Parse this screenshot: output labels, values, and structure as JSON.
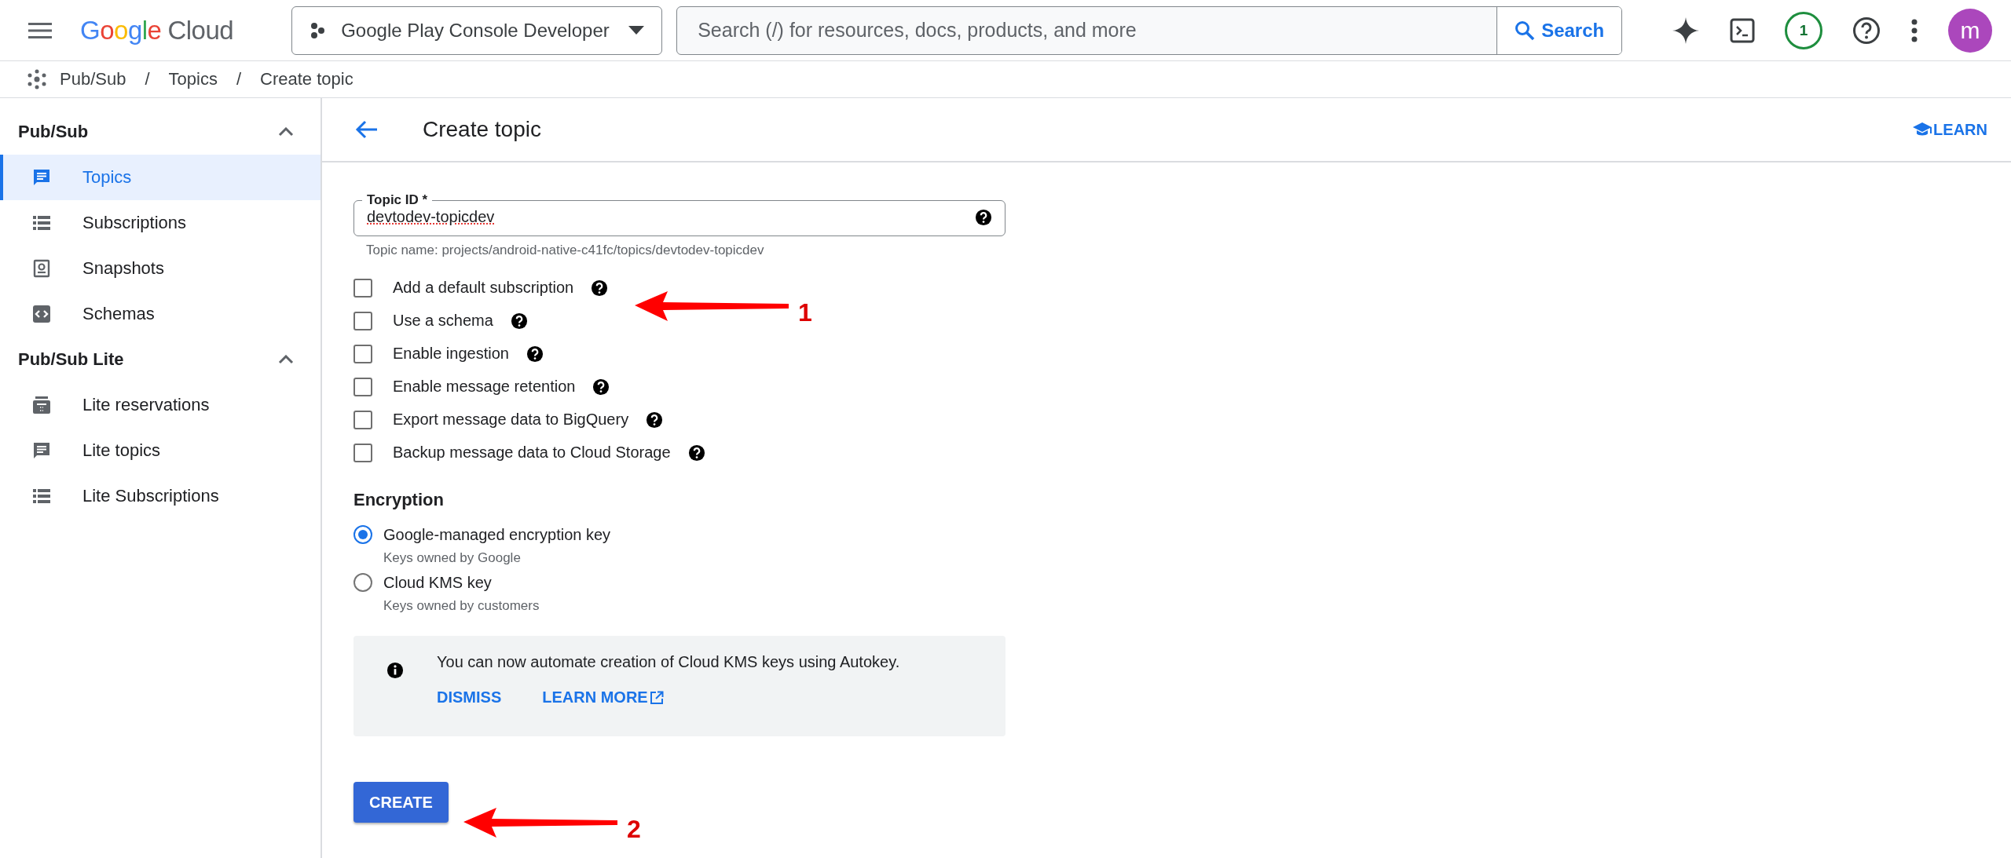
{
  "topbar": {
    "logo": {
      "google": "Google",
      "cloud": "Cloud"
    },
    "project": "Google Play Console Developer",
    "search": {
      "placeholder": "Search (/) for resources, docs, products, and more",
      "button": "Search"
    },
    "notification_count": "1",
    "avatar_letter": "m"
  },
  "breadcrumb": [
    {
      "kind": "link",
      "text": "Pub/Sub"
    },
    {
      "kind": "separator",
      "text": "/"
    },
    {
      "kind": "link",
      "text": "Topics"
    },
    {
      "kind": "separator",
      "text": "/"
    },
    {
      "kind": "link",
      "text": "Create topic"
    }
  ],
  "sidebar": {
    "sections": [
      {
        "title": "Pub/Sub",
        "expanded": true,
        "items": [
          {
            "label": "Topics",
            "selected": true
          },
          {
            "label": "Subscriptions",
            "selected": false
          },
          {
            "label": "Snapshots",
            "selected": false
          },
          {
            "label": "Schemas",
            "selected": false
          }
        ]
      },
      {
        "title": "Pub/Sub Lite",
        "expanded": true,
        "items": [
          {
            "label": "Lite reservations",
            "selected": false
          },
          {
            "label": "Lite topics",
            "selected": false
          },
          {
            "label": "Lite Subscriptions",
            "selected": false
          }
        ]
      }
    ]
  },
  "page": {
    "title": "Create topic",
    "learn": "LEARN"
  },
  "form": {
    "topic_id": {
      "label": "Topic ID *",
      "value": "devtodev-topicdev",
      "helper": "Topic name: projects/android-native-c41fc/topics/devtodev-topicdev"
    },
    "options": [
      {
        "label": "Add a default subscription",
        "checked": false
      },
      {
        "label": "Use a schema",
        "checked": false
      },
      {
        "label": "Enable ingestion",
        "checked": false
      },
      {
        "label": "Enable message retention",
        "checked": false
      },
      {
        "label": "Export message data to BigQuery",
        "checked": false
      },
      {
        "label": "Backup message data to Cloud Storage",
        "checked": false
      }
    ],
    "encryption": {
      "title": "Encryption",
      "choices": [
        {
          "label": "Google-managed encryption key",
          "hint": "Keys owned by Google",
          "selected": true
        },
        {
          "label": "Cloud KMS key",
          "hint": "Keys owned by customers",
          "selected": false
        }
      ]
    },
    "notice": {
      "text": "You can now automate creation of Cloud KMS keys using Autokey.",
      "dismiss": "DISMISS",
      "learn_more": "LEARN MORE"
    },
    "create": "CREATE"
  },
  "annotations": [
    {
      "label": "1"
    },
    {
      "label": "2"
    }
  ]
}
